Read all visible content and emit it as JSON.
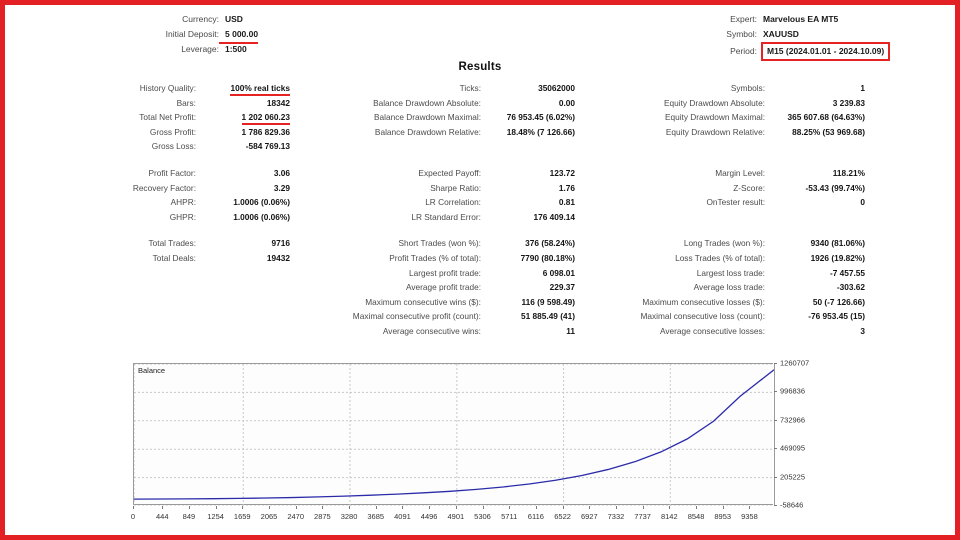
{
  "theme": {
    "frame_color": "#e32124",
    "highlight_color": "#e52322",
    "curve_color": "#2b2baa",
    "page_bg": "#ffffff"
  },
  "header": {
    "left": [
      {
        "label": "Currency:",
        "value": "USD",
        "highlight": "none"
      },
      {
        "label": "Initial Deposit:",
        "value": "5 000.00",
        "highlight": "underline"
      },
      {
        "label": "Leverage:",
        "value": "1:500",
        "highlight": "none"
      }
    ],
    "right": [
      {
        "label": "Expert:",
        "value": "Marvelous EA MT5",
        "highlight": "none"
      },
      {
        "label": "Symbol:",
        "value": "XAUUSD",
        "highlight": "none"
      },
      {
        "label": "Period:",
        "value": "M15 (2024.01.01 - 2024.10.09)",
        "highlight": "box"
      }
    ]
  },
  "title": "Results",
  "stats": {
    "group1": [
      {
        "l1": "History Quality:",
        "v1": "100% real ticks",
        "u1": true,
        "l2": "Ticks:",
        "v2": "35062000",
        "l3": "Symbols:",
        "v3": "1"
      },
      {
        "l1": "Bars:",
        "v1": "18342",
        "l2": "Balance Drawdown Absolute:",
        "v2": "0.00",
        "l3": "Equity Drawdown Absolute:",
        "v3": "3 239.83"
      },
      {
        "l1": "Total Net Profit:",
        "v1": "1 202 060.23",
        "u1": true,
        "l2": "Balance Drawdown Maximal:",
        "v2": "76 953.45 (6.02%)",
        "l3": "Equity Drawdown Maximal:",
        "v3": "365 607.68 (64.63%)"
      },
      {
        "l1": "Gross Profit:",
        "v1": "1 786 829.36",
        "l2": "Balance Drawdown Relative:",
        "v2": "18.48% (7 126.66)",
        "l3": "Equity Drawdown Relative:",
        "v3": "88.25% (53 969.68)"
      },
      {
        "l1": "Gross Loss:",
        "v1": "-584 769.13",
        "l2": "",
        "v2": "",
        "l3": "",
        "v3": ""
      }
    ],
    "group2": [
      {
        "l1": "Profit Factor:",
        "v1": "3.06",
        "l2": "Expected Payoff:",
        "v2": "123.72",
        "l3": "Margin Level:",
        "v3": "118.21%"
      },
      {
        "l1": "Recovery Factor:",
        "v1": "3.29",
        "l2": "Sharpe Ratio:",
        "v2": "1.76",
        "l3": "Z-Score:",
        "v3": "-53.43 (99.74%)"
      },
      {
        "l1": "AHPR:",
        "v1": "1.0006 (0.06%)",
        "l2": "LR Correlation:",
        "v2": "0.81",
        "l3": "OnTester result:",
        "v3": "0"
      },
      {
        "l1": "GHPR:",
        "v1": "1.0006 (0.06%)",
        "l2": "LR Standard Error:",
        "v2": "176 409.14",
        "l3": "",
        "v3": ""
      }
    ],
    "group3": [
      {
        "l1": "Total Trades:",
        "v1": "9716",
        "l2": "Short Trades (won %):",
        "v2": "376 (58.24%)",
        "l3": "Long Trades (won %):",
        "v3": "9340 (81.06%)"
      },
      {
        "l1": "Total Deals:",
        "v1": "19432",
        "l2": "Profit Trades (% of total):",
        "v2": "7790 (80.18%)",
        "l3": "Loss Trades (% of total):",
        "v3": "1926 (19.82%)"
      },
      {
        "l1": "",
        "v1": "",
        "l2": "Largest profit trade:",
        "v2": "6 098.01",
        "l3": "Largest loss trade:",
        "v3": "-7 457.55"
      },
      {
        "l1": "",
        "v1": "",
        "l2": "Average profit trade:",
        "v2": "229.37",
        "l3": "Average loss trade:",
        "v3": "-303.62"
      },
      {
        "l1": "",
        "v1": "",
        "l2": "Maximum consecutive wins ($):",
        "v2": "116 (9 598.49)",
        "l3": "Maximum consecutive losses ($):",
        "v3": "50 (-7 126.66)"
      },
      {
        "l1": "",
        "v1": "",
        "l2": "Maximal consecutive profit (count):",
        "v2": "51 885.49 (41)",
        "l3": "Maximal consecutive loss (count):",
        "v3": "-76 953.45 (15)"
      },
      {
        "l1": "",
        "v1": "",
        "l2": "Average consecutive wins:",
        "v2": "11",
        "l3": "Average consecutive losses:",
        "v3": "3"
      }
    ]
  },
  "chart_data": {
    "type": "line",
    "title": "",
    "legend": "Balance",
    "legend_position": "top-left",
    "xlabel": "",
    "ylabel": "",
    "grid": true,
    "series_color": "#2b2baa",
    "xlim": [
      0,
      9716
    ],
    "ylim": [
      -58646,
      1260707
    ],
    "xticks": [
      0,
      444,
      849,
      1254,
      1659,
      2065,
      2470,
      2875,
      3280,
      3685,
      4091,
      4496,
      4901,
      5306,
      5711,
      6116,
      6522,
      6927,
      7332,
      7737,
      8142,
      8548,
      8953,
      9358
    ],
    "yticks": [
      1260707,
      996836,
      732966,
      469095,
      205225,
      -58646
    ],
    "x": [
      0,
      400,
      800,
      1200,
      1600,
      2000,
      2400,
      2800,
      3200,
      3600,
      4000,
      4400,
      4800,
      5200,
      5600,
      6000,
      6400,
      6800,
      7200,
      7600,
      8000,
      8400,
      8800,
      9200,
      9716
    ],
    "values": [
      5000,
      6200,
      7600,
      9500,
      12000,
      15500,
      20000,
      26000,
      33000,
      42000,
      52000,
      64000,
      78000,
      96000,
      118000,
      146000,
      181000,
      225000,
      281000,
      352000,
      444000,
      565000,
      730000,
      960000,
      1207060
    ]
  }
}
